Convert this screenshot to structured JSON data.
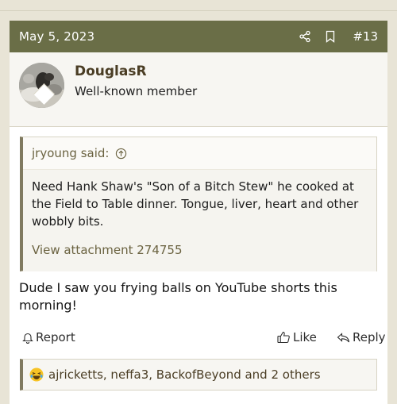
{
  "post": {
    "date": "May 5, 2023",
    "number": "#13",
    "icons": {
      "share": "share-icon",
      "bookmark": "bookmark-icon"
    }
  },
  "user": {
    "name": "DouglasR",
    "title": "Well-known member"
  },
  "quote": {
    "author_label": "jryoung said:",
    "text": "Need Hank Shaw's \"Son of a Bitch Stew\" he cooked at the Field to Table dinner. Tongue, liver, heart and other wobbly bits.",
    "attachment": "View attachment 274755"
  },
  "message": "Dude I saw you frying balls on YouTube shorts this morning!",
  "actions": {
    "report": "Report",
    "like": "Like",
    "reply": "Reply"
  },
  "reactions": {
    "emoji": "laughing-emoji",
    "text": "ajricketts, neffa3, BackofBeyond and 2 others"
  },
  "colors": {
    "header_bg": "#6a6e47",
    "accent": "#807a60",
    "username": "#4a3d24",
    "link": "#6b6341"
  }
}
